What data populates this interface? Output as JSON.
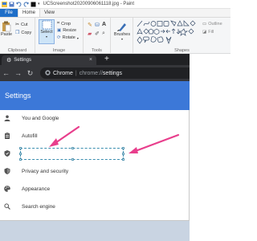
{
  "paint": {
    "title": "UCScreenshot20200906061118.jpg - Paint",
    "tabs": {
      "file": "File",
      "home": "Home",
      "view": "View"
    },
    "clipboard": {
      "paste": "Paste",
      "cut": "Cut",
      "copy": "Copy",
      "label": "Clipboard"
    },
    "image": {
      "select": "Select",
      "crop": "Crop",
      "resize": "Resize",
      "rotate": "Rotate",
      "label": "Image"
    },
    "tools": {
      "label": "Tools"
    },
    "brushes": {
      "label": "Brushes"
    },
    "shapes": {
      "outline": "Outline",
      "fill": "Fill",
      "label": "Shapes"
    }
  },
  "chrome": {
    "tab_title": "Settings",
    "new_tab": "+",
    "close": "×",
    "address_site": "Chrome",
    "address_sep": "|",
    "address_scheme": "chrome://",
    "address_path": "settings"
  },
  "settings": {
    "header": "Settings",
    "menu": [
      {
        "label": "You and Google",
        "icon": "person-icon"
      },
      {
        "label": "Autofill",
        "icon": "clipboard-icon"
      },
      {
        "label": "",
        "icon": "shield-icon"
      },
      {
        "label": "Privacy and security",
        "icon": "shield-icon"
      },
      {
        "label": "Appearance",
        "icon": "palette-icon"
      },
      {
        "label": "Search engine",
        "icon": "search-icon"
      }
    ]
  },
  "colors": {
    "arrow": "#e83e8c",
    "settings_header": "#3c78d8",
    "file_tab": "#1e6ec8"
  }
}
